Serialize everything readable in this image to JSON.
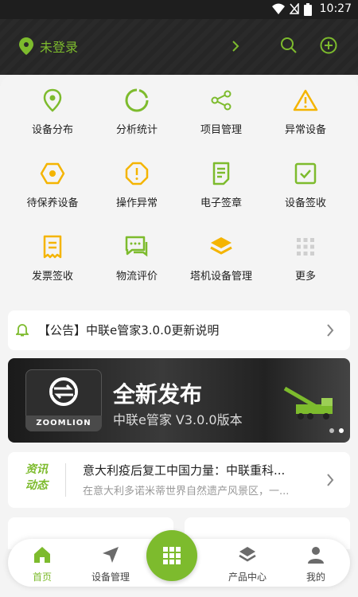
{
  "status": {
    "time": "10:27"
  },
  "header": {
    "login_text": "未登录"
  },
  "grid": {
    "items": [
      "设备分布",
      "分析统计",
      "项目管理",
      "异常设备",
      "待保养设备",
      "操作异常",
      "电子签章",
      "设备签收",
      "发票签收",
      "物流评价",
      "塔机设备管理",
      "更多"
    ]
  },
  "notice": {
    "text": "【公告】中联e管家3.0.0更新说明"
  },
  "banner": {
    "logo_text": "ZOOMLION",
    "title": "全新发布",
    "subtitle": "中联e管家 V3.0.0版本"
  },
  "news": {
    "tag": "资讯动态",
    "title": "意大利疫后复工中国力量：中联重科...",
    "desc": "在意大利多诺米蒂世界自然遗产风景区，一..."
  },
  "tabbar": {
    "tabs": [
      "首页",
      "设备管理",
      "产品中心",
      "我的"
    ]
  },
  "colors": {
    "accent": "#7dbb2d",
    "warning": "#f4b400"
  }
}
